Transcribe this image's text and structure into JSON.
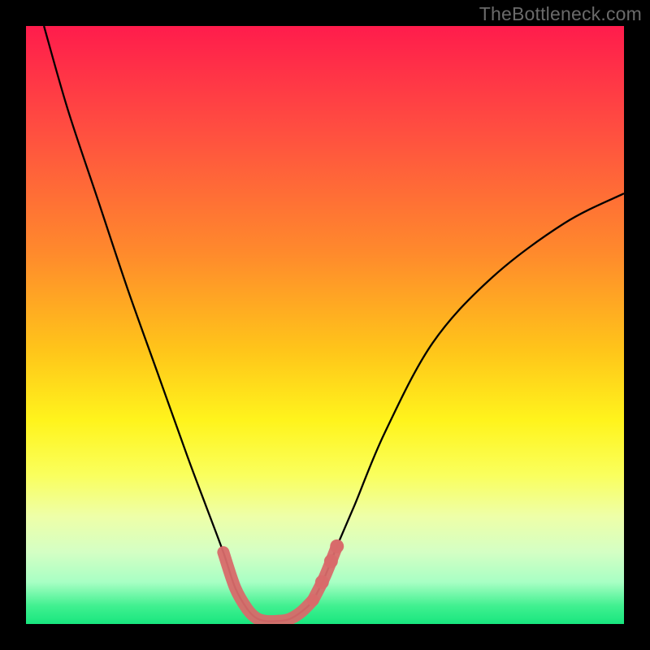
{
  "watermark": "TheBottleneck.com",
  "chart_data": {
    "type": "line",
    "title": "",
    "xlabel": "",
    "ylabel": "",
    "xlim": [
      0,
      100
    ],
    "ylim": [
      0,
      100
    ],
    "series": [
      {
        "name": "bottleneck-curve",
        "x": [
          3,
          7,
          12,
          17,
          22,
          27,
          30,
          33,
          35,
          37,
          38.5,
          40,
          42,
          44,
          46,
          48,
          50,
          52,
          55,
          60,
          68,
          78,
          90,
          100
        ],
        "values": [
          100,
          86,
          71,
          56,
          42,
          28,
          20,
          12,
          6,
          2.5,
          1,
          0.5,
          0.5,
          0.8,
          2,
          4,
          8,
          13,
          20,
          32,
          47,
          58,
          67,
          72
        ]
      }
    ],
    "overlays": [
      {
        "name": "highlight-segment-left",
        "type": "path-highlight",
        "color": "#d86a6a",
        "x": [
          33,
          35,
          37,
          38.5,
          40,
          42,
          44,
          46,
          48
        ],
        "values": [
          12,
          6,
          2.5,
          1,
          0.5,
          0.5,
          0.8,
          2,
          4
        ]
      },
      {
        "name": "highlight-segment-right",
        "type": "path-highlight",
        "color": "#d86a6a",
        "x": [
          48,
          50,
          52
        ],
        "values": [
          4,
          8,
          13
        ]
      },
      {
        "name": "highlight-dots",
        "type": "dots",
        "color": "#d86a6a",
        "x": [
          49.5,
          51,
          52
        ],
        "values": [
          7,
          10.5,
          13
        ]
      }
    ]
  }
}
